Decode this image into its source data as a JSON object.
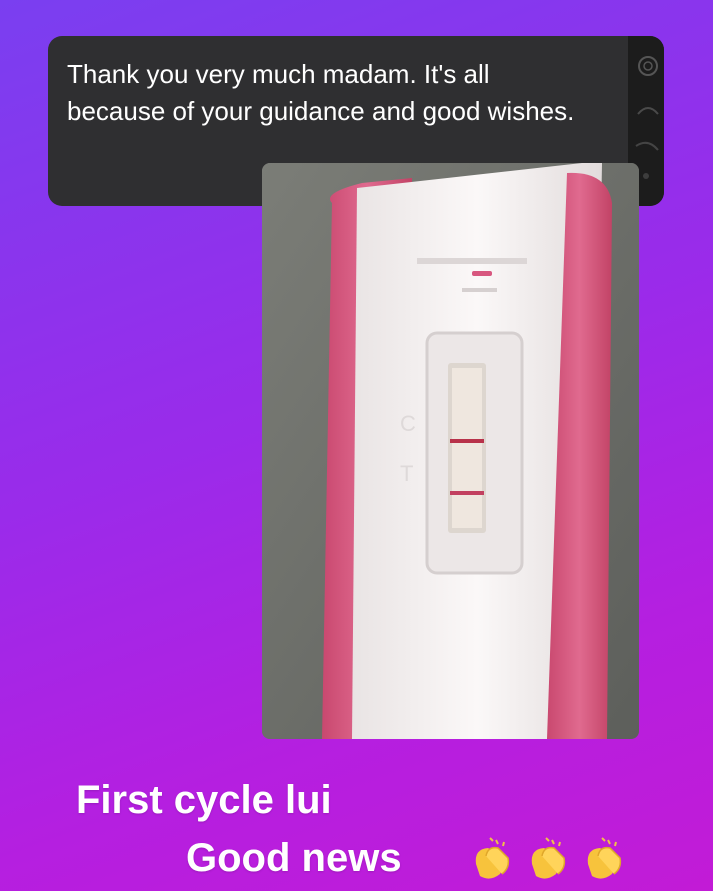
{
  "message": {
    "text": "Thank you very much madam. It's all because of your guidance and good wishes."
  },
  "photo": {
    "strip_letters": [
      "C",
      "T"
    ]
  },
  "caption": {
    "line1": "First cycle lui",
    "line2": "Good news",
    "emoji": [
      "clapping-hands",
      "clapping-hands",
      "clapping-hands"
    ]
  },
  "colors": {
    "bubble": "#2f2f31",
    "strip_pink": "#d9587e",
    "caption_text": "#ffffff"
  }
}
